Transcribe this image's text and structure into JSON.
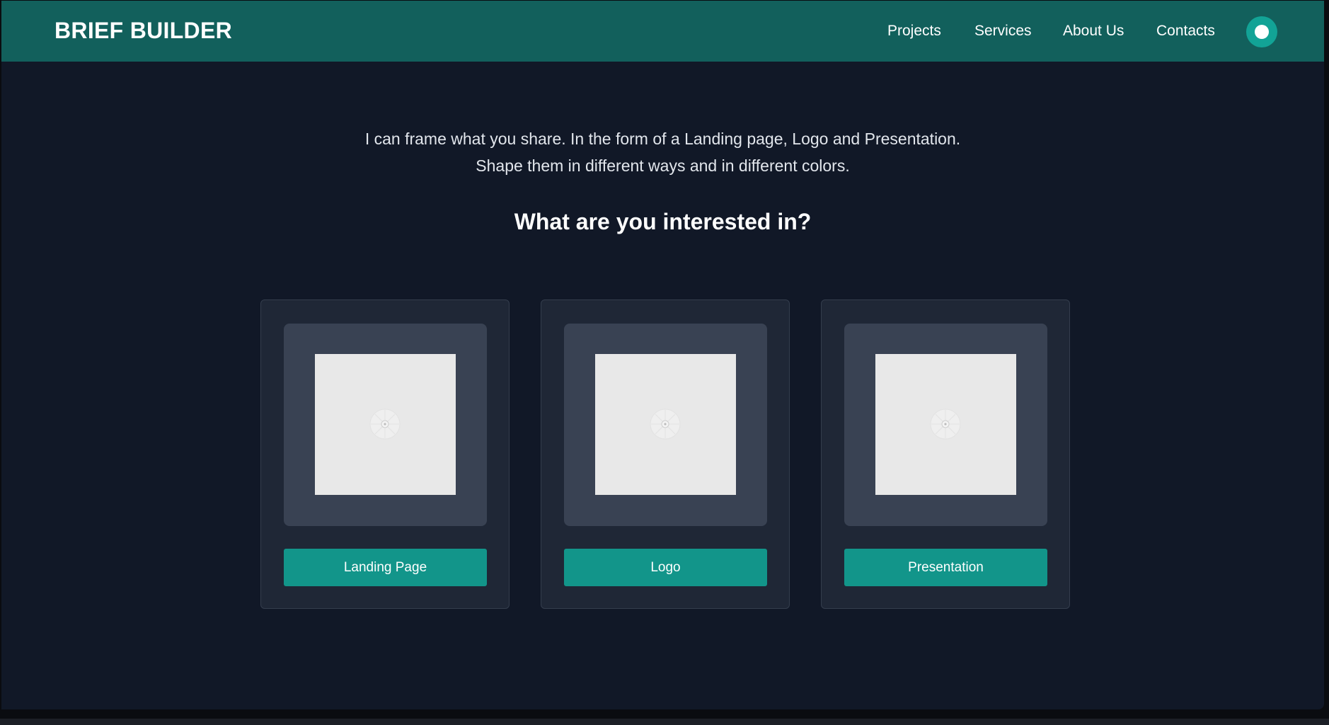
{
  "header": {
    "brand": "BRIEF BUILDER",
    "nav": [
      {
        "label": "Projects"
      },
      {
        "label": "Services"
      },
      {
        "label": "About Us"
      },
      {
        "label": "Contacts"
      }
    ],
    "theme_toggle_icon": "toggle-icon"
  },
  "intro": {
    "line1": "I can frame what you share. In the form of a Landing page, Logo and Presentation.",
    "line2": "Shape them in different ways and in different colors."
  },
  "question": "What are you interested in?",
  "cards": [
    {
      "button_label": "Landing Page",
      "image_icon": "image-placeholder-icon"
    },
    {
      "button_label": "Logo",
      "image_icon": "image-placeholder-icon"
    },
    {
      "button_label": "Presentation",
      "image_icon": "image-placeholder-icon"
    }
  ],
  "colors": {
    "header_bg": "#12605c",
    "page_bg": "#111827",
    "card_bg": "#1f2736",
    "accent": "#12958a",
    "toggle": "#12a396"
  }
}
